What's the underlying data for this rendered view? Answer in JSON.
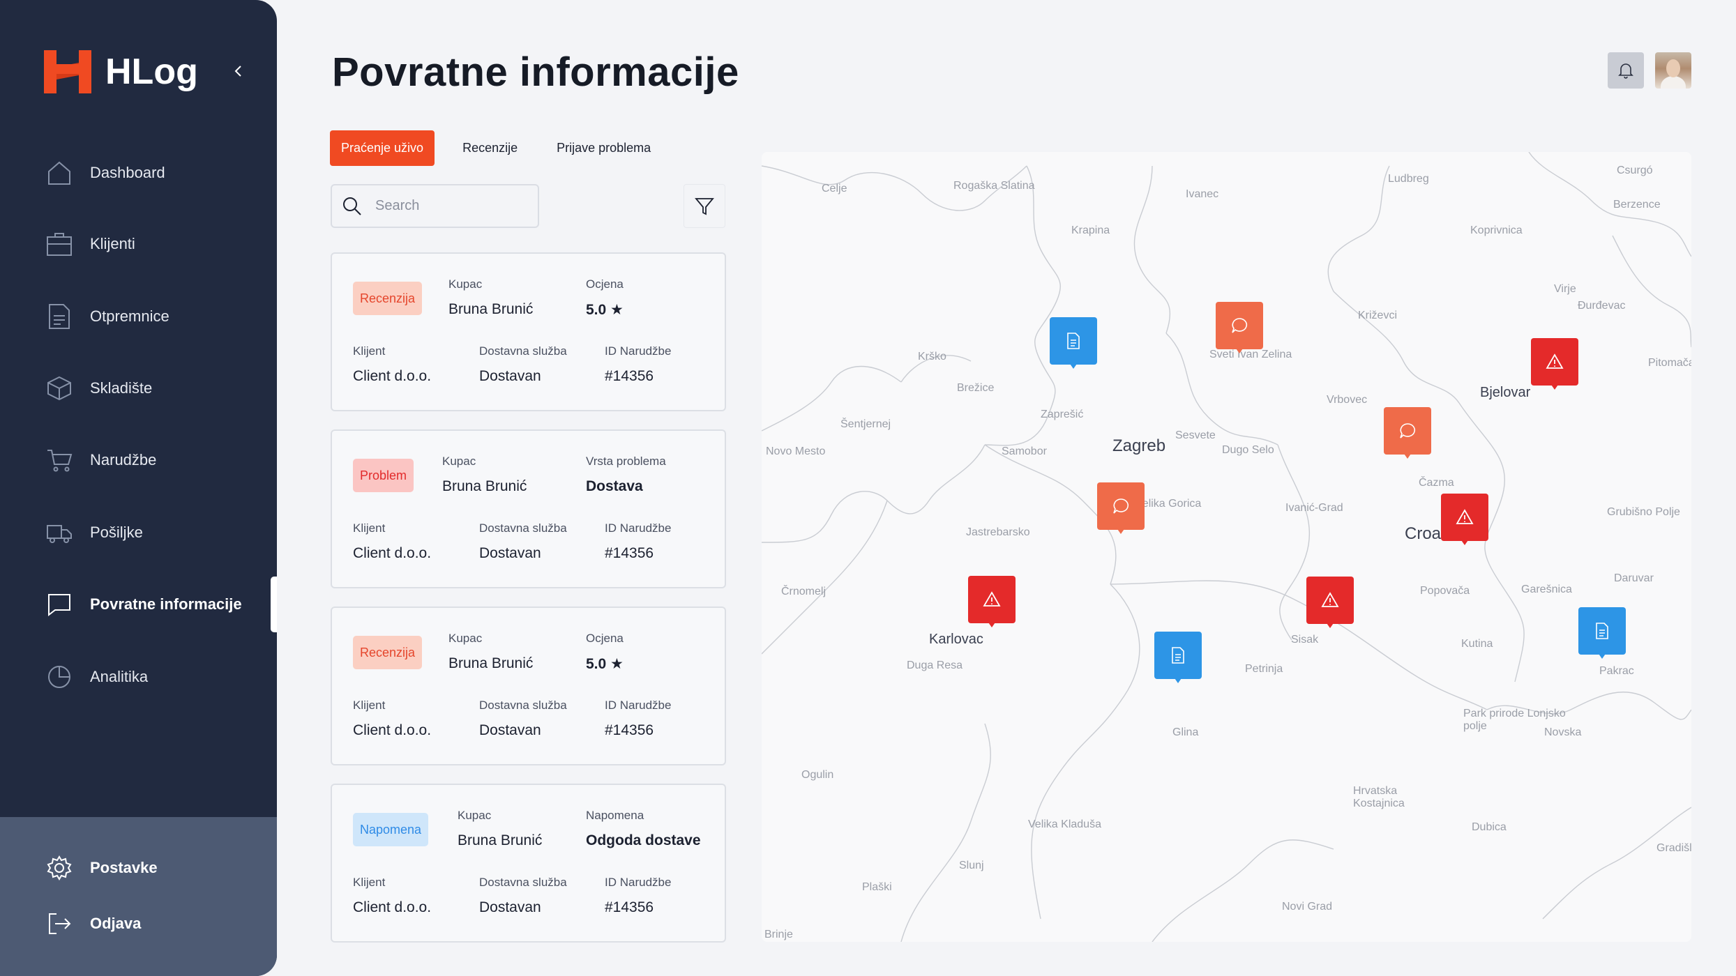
{
  "app": {
    "name": "HLog"
  },
  "sidebar": {
    "items": [
      {
        "label": "Dashboard",
        "icon": "home-icon"
      },
      {
        "label": "Klijenti",
        "icon": "briefcase-icon"
      },
      {
        "label": "Otpremnice",
        "icon": "document-icon"
      },
      {
        "label": "Skladište",
        "icon": "box-icon"
      },
      {
        "label": "Narudžbe",
        "icon": "cart-icon"
      },
      {
        "label": "Pošiljke",
        "icon": "truck-icon"
      },
      {
        "label": "Povratne informacije",
        "icon": "chat-icon",
        "active": true
      },
      {
        "label": "Analitika",
        "icon": "pie-chart-icon"
      }
    ],
    "bottom": [
      {
        "label": "Postavke",
        "icon": "gear-icon"
      },
      {
        "label": "Odjava",
        "icon": "logout-icon"
      }
    ]
  },
  "page": {
    "title": "Povratne informacije"
  },
  "tabs": [
    {
      "label": "Praćenje uživo",
      "active": true
    },
    {
      "label": "Recenzije"
    },
    {
      "label": "Prijave problema"
    }
  ],
  "search": {
    "placeholder": "Search"
  },
  "cards": [
    {
      "badge": "Recenzija",
      "type": "review",
      "f1_label": "Kupac",
      "f1_value": "Bruna Brunić",
      "f2_label": "Ocjena",
      "f2_value": "5.0 ★",
      "f3_label": "Klijent",
      "f3_value": "Client d.o.o.",
      "f4_label": "Dostavna služba",
      "f4_value": "Dostavan",
      "f5_label": "ID Narudžbe",
      "f5_value": "#14356"
    },
    {
      "badge": "Problem",
      "type": "problem",
      "f1_label": "Kupac",
      "f1_value": "Bruna Brunić",
      "f2_label": "Vrsta problema",
      "f2_value": "Dostava",
      "f3_label": "Klijent",
      "f3_value": "Client d.o.o.",
      "f4_label": "Dostavna služba",
      "f4_value": "Dostavan",
      "f5_label": "ID Narudžbe",
      "f5_value": "#14356"
    },
    {
      "badge": "Recenzija",
      "type": "review",
      "f1_label": "Kupac",
      "f1_value": "Bruna Brunić",
      "f2_label": "Ocjena",
      "f2_value": "5.0 ★",
      "f3_label": "Klijent",
      "f3_value": "Client d.o.o.",
      "f4_label": "Dostavna služba",
      "f4_value": "Dostavan",
      "f5_label": "ID Narudžbe",
      "f5_value": "#14356"
    },
    {
      "badge": "Napomena",
      "type": "note",
      "f1_label": "Kupac",
      "f1_value": "Bruna Brunić",
      "f2_label": "Napomena",
      "f2_value": "Odgoda dostave",
      "f3_label": "Klijent",
      "f3_value": "Client d.o.o.",
      "f4_label": "Dostavna služba",
      "f4_value": "Dostavan",
      "f5_label": "ID Narudžbe",
      "f5_value": "#14356"
    }
  ],
  "map": {
    "cities": [
      "Celje",
      "Rogaška Slatina",
      "Ivanec",
      "Ludbreg",
      "Csurgó",
      "Berzence",
      "Krapina",
      "Koprivnica",
      "Virje",
      "Đurđevac",
      "Križevci",
      "Krško",
      "Sveti Ivan Zelina",
      "Pitomača",
      "Brežice",
      "Bjelovar",
      "Šentjernej",
      "Zaprešić",
      "Vrbovec",
      "Novo Mesto",
      "Samobor",
      "Zagreb",
      "Sesvete",
      "Dugo Selo",
      "Čazma",
      "Velika Gorica",
      "Ivanić-Grad",
      "Grubišno Polje",
      "Jastrebarsko",
      "Croatia",
      "Črnomelj",
      "Popovača",
      "Garešnica",
      "Daruvar",
      "Karlovac",
      "Sisak",
      "Kutina",
      "Duga Resa",
      "Petrinja",
      "Pakrac",
      "Park prirode Lonjsko polje",
      "Glina",
      "Novska",
      "Ogulin",
      "Hrvatska Kostajnica",
      "Velika Kladuša",
      "Dubica",
      "Gradišl",
      "Slunj",
      "Plaški",
      "Novi Grad",
      "Brinje"
    ],
    "markers": [
      {
        "kind": "note",
        "icon": "document-icon",
        "color": "#2d95e6"
      },
      {
        "kind": "review",
        "icon": "chat-icon",
        "color": "#ef6b49"
      },
      {
        "kind": "problem",
        "icon": "warning-icon",
        "color": "#e42a2a"
      },
      {
        "kind": "review",
        "icon": "chat-icon",
        "color": "#ef6b49"
      },
      {
        "kind": "review",
        "icon": "chat-icon",
        "color": "#ef6b49"
      },
      {
        "kind": "problem",
        "icon": "warning-icon",
        "color": "#e42a2a"
      },
      {
        "kind": "problem",
        "icon": "warning-icon",
        "color": "#e42a2a"
      },
      {
        "kind": "problem",
        "icon": "warning-icon",
        "color": "#e42a2a"
      },
      {
        "kind": "note",
        "icon": "document-icon",
        "color": "#2d95e6"
      },
      {
        "kind": "note",
        "icon": "document-icon",
        "color": "#2d95e6"
      }
    ]
  },
  "colors": {
    "accent": "#f04a22",
    "sidebar": "#212a40",
    "sidebar_bottom": "#4d5a73"
  }
}
